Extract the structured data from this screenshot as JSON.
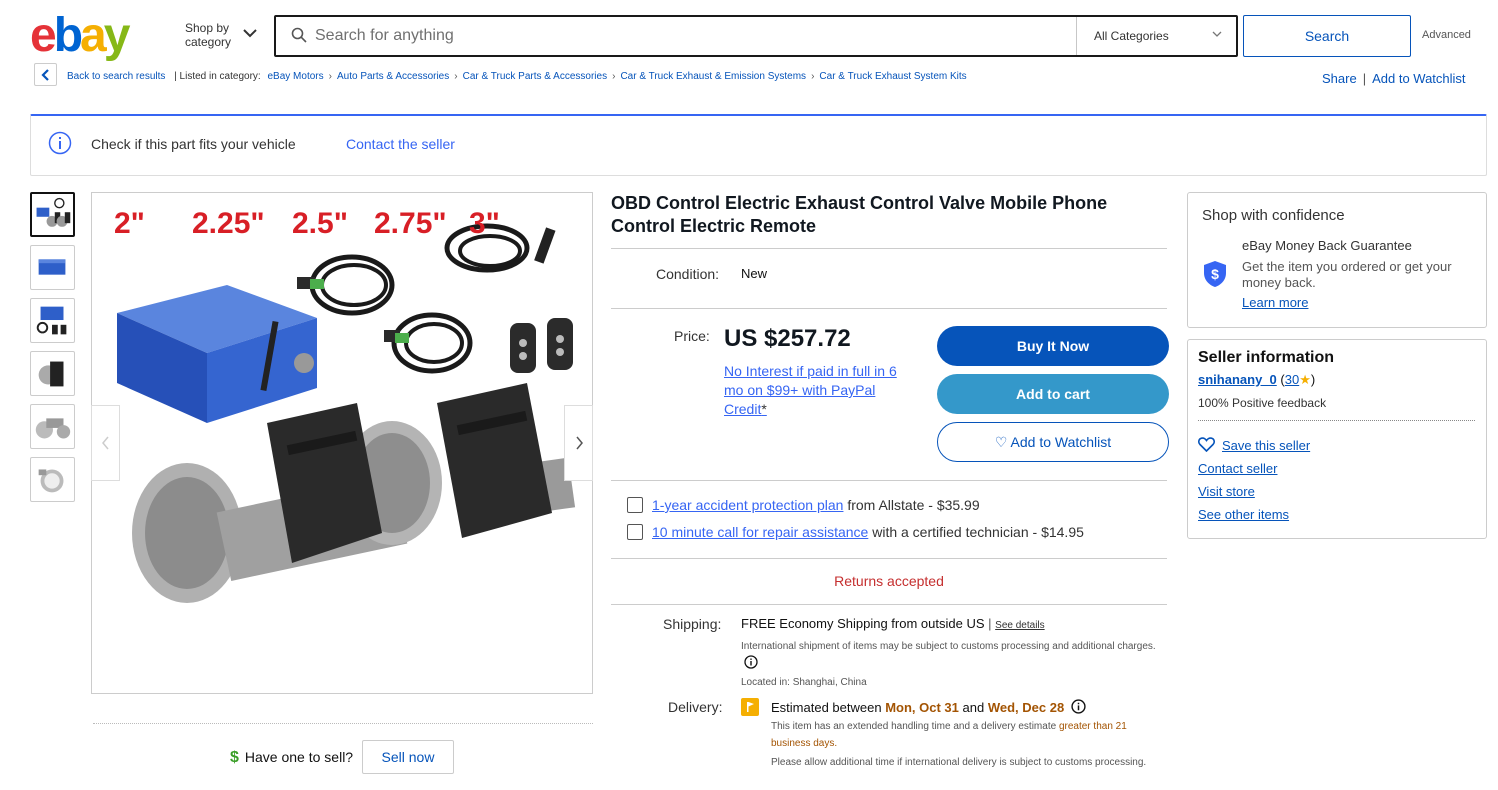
{
  "header": {
    "logo_letters": [
      "e",
      "b",
      "a",
      "y"
    ],
    "shop_by_line1": "Shop by",
    "shop_by_line2": "category",
    "search_placeholder": "Search for anything",
    "category_selected": "All Categories",
    "search_button": "Search",
    "advanced": "Advanced"
  },
  "breadcrumb": {
    "back": "Back to search results",
    "listed_in": "| Listed in category:",
    "items": [
      "eBay Motors",
      "Auto Parts & Accessories",
      "Car & Truck Parts & Accessories",
      "Car & Truck Exhaust & Emission Systems",
      "Car & Truck Exhaust System Kits"
    ],
    "share": "Share",
    "add_watchlist": "Add to Watchlist"
  },
  "fit_banner": {
    "text": "Check if this part fits your vehicle",
    "contact": "Contact the seller"
  },
  "image": {
    "sizes": [
      "2\"",
      "2.25\"",
      "2.5\"",
      "2.75\"",
      "3\""
    ]
  },
  "listing": {
    "title": "OBD Control Electric Exhaust Control Valve Mobile Phone Control Electric Remote",
    "condition_label": "Condition:",
    "condition": "New",
    "price_label": "Price:",
    "price": "US $257.72",
    "credit_text": "No Interest if paid in full in 6 mo on $99+ with PayPal Credit",
    "credit_star": "*",
    "buy_now": "Buy It Now",
    "add_to_cart": "Add to cart",
    "add_to_watchlist": "Add to Watchlist",
    "plans": [
      {
        "link": "1-year accident protection plan",
        "rest": "from Allstate - $35.99"
      },
      {
        "link": "10 minute call for repair assistance",
        "rest": "with a certified technician - $14.95"
      }
    ],
    "returns": "Returns accepted",
    "shipping_label": "Shipping:",
    "shipping_free": "FREE",
    "shipping_text": "Economy Shipping from outside US",
    "shipping_sep": "|",
    "see_details": "See details",
    "intl_note": "International shipment of items may be subject to customs processing and additional charges.",
    "located": "Located in: Shanghai, China",
    "delivery_label": "Delivery:",
    "delivery_pre": "Estimated between",
    "delivery_from": "Mon, Oct 31",
    "delivery_and": "and",
    "delivery_to": "Wed, Dec 28",
    "handling_note": "This item has an extended handling time and a delivery estimate",
    "handling_emph": "greater than 21 business days.",
    "intl_delivery_note": "Please allow additional time if international delivery is subject to customs processing.",
    "have_one": "Have one to sell?",
    "sell_now": "Sell now"
  },
  "confidence": {
    "title": "Shop with confidence",
    "mbg_title": "eBay Money Back Guarantee",
    "mbg_desc": "Get the item you ordered or get your money back.",
    "learn_more": "Learn more"
  },
  "seller": {
    "title": "Seller information",
    "name": "snihanany_0",
    "open_paren": "(",
    "score": "30",
    "close_paren": ")",
    "feedback": "100% Positive feedback",
    "save": "Save this seller",
    "contact": "Contact seller",
    "visit_store": "Visit store",
    "other_items": "See other items"
  },
  "colors": {
    "primary_blue": "#0654ba",
    "cart_blue": "#3498ca",
    "returns_red": "#c52f2f",
    "delivery_orange": "#a35403"
  }
}
